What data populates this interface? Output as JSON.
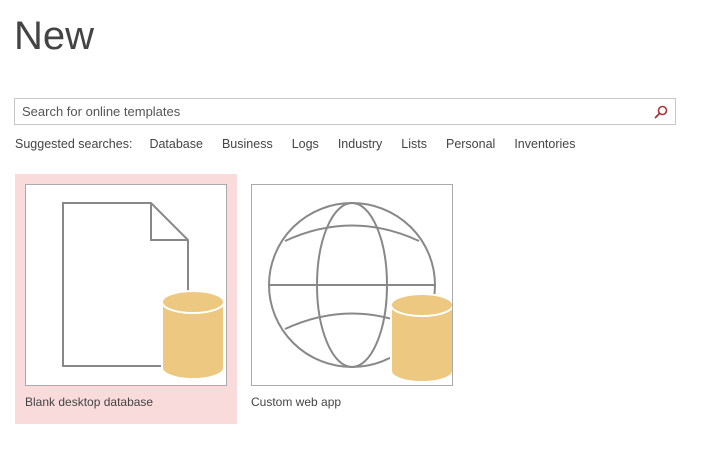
{
  "page": {
    "title": "New"
  },
  "search": {
    "placeholder": "Search for online templates",
    "value": ""
  },
  "suggested": {
    "label": "Suggested searches:",
    "items": [
      "Database",
      "Business",
      "Logs",
      "Industry",
      "Lists",
      "Personal",
      "Inventories"
    ]
  },
  "templates": [
    {
      "label": "Blank desktop database",
      "icon": "blank-document-database-icon",
      "selected": true
    },
    {
      "label": "Custom web app",
      "icon": "globe-database-icon",
      "selected": false
    }
  ],
  "colors": {
    "accent": "#a4373a",
    "selected_bg": "#f9dbdb",
    "cylinder": "#ecc880",
    "line": "#888888"
  }
}
